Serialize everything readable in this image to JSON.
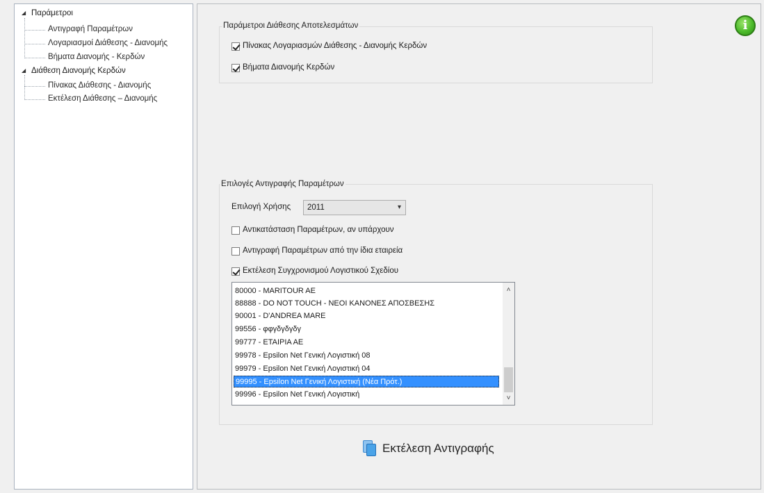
{
  "tree": {
    "root1": "Παράμετροι",
    "root1_children": [
      "Αντιγραφή Παραμέτρων",
      "Λογαριασμοί Διάθεσης - Διανομής",
      "Βήματα Διανομής - Κερδών"
    ],
    "root2": "Διάθεση Διανομής Κερδών",
    "root2_children": [
      "Πίνακας Διάθεσης - Διανομής",
      "Εκτέλεση Διάθεσης – Διανομής"
    ]
  },
  "info_icon": {
    "glyph": "i",
    "color": "#4dbb2b",
    "icon": "info-icon"
  },
  "results_group": {
    "title": "Παράμετροι Διάθεσης Αποτελεσμάτων",
    "options": [
      {
        "label": "Πίνακας Λογαριασμών Διάθεσης - Διανομής Κερδών",
        "checked": true
      },
      {
        "label": "Βήματα Διανομής Κερδών",
        "checked": true
      }
    ]
  },
  "copy_group": {
    "title": "Επιλογές Αντιγραφής Παραμέτρων",
    "year_label": "Επιλογή Χρήσης",
    "year_value": "2011",
    "options": [
      {
        "label": "Αντικατάσταση Παραμέτρων, αν υπάρχουν",
        "checked": false
      },
      {
        "label": "Αντιγραφή Παραμέτρων από την ίδια εταιρεία",
        "checked": false
      },
      {
        "label": "Εκτέλεση Συγχρονισμού Λογιστικού Σχεδίου",
        "checked": true
      }
    ],
    "companies": [
      "80000 - MARITOUR AE",
      "88888 - DO NOT TOUCH - ΝΕΟΙ ΚΑΝΟΝΕΣ ΑΠΟΣΒΕΣΗΣ",
      "90001 - D'ANDREA MARE",
      "99556 - φφγδγδγδγ",
      "99777 - ΕΤΑΙΡΙΑ ΑΕ",
      "99978 - Epsilon Net Γενική Λογιστική 08",
      "99979 - Epsilon Net Γενική Λογιστική 04",
      "99995 - Epsilon Net Γενική Λογιστική (Νέα Πρότ.)",
      "99996 - Epsilon Net Γενική Λογιστική"
    ],
    "selected_index": 7
  },
  "execute_button": {
    "label": "Εκτέλεση Αντιγραφής",
    "icon": "copy-icon"
  }
}
